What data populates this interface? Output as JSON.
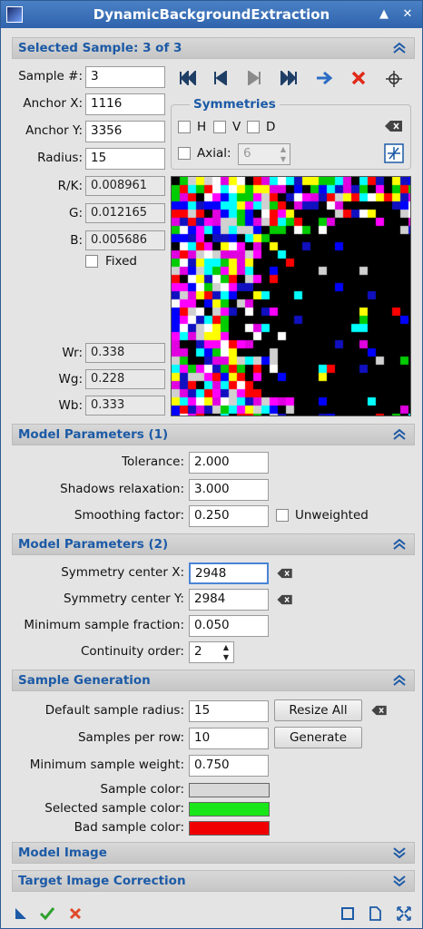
{
  "window": {
    "title": "DynamicBackgroundExtraction"
  },
  "selected_sample": {
    "header": "Selected Sample: 3 of 3",
    "sample_label": "Sample #:",
    "sample_value": "3",
    "anchor_x_label": "Anchor X:",
    "anchor_x_value": "1116",
    "anchor_y_label": "Anchor Y:",
    "anchor_y_value": "3356",
    "radius_label": "Radius:",
    "radius_value": "15",
    "rk_label": "R/K:",
    "rk_value": "0.008961",
    "g_label": "G:",
    "g_value": "0.012165",
    "b_label": "B:",
    "b_value": "0.005686",
    "fixed_label": "Fixed",
    "wr_label": "Wr:",
    "wr_value": "0.338",
    "wg_label": "Wg:",
    "wg_value": "0.228",
    "wb_label": "Wb:",
    "wb_value": "0.333",
    "symmetries": {
      "title": "Symmetries",
      "h": "H",
      "v": "V",
      "d": "D",
      "axial_label": "Axial:",
      "axial_value": "6"
    }
  },
  "model_params_1": {
    "header": "Model Parameters (1)",
    "tolerance_label": "Tolerance:",
    "tolerance_value": "2.000",
    "shadows_label": "Shadows relaxation:",
    "shadows_value": "3.000",
    "smoothing_label": "Smoothing factor:",
    "smoothing_value": "0.250",
    "unweighted_label": "Unweighted"
  },
  "model_params_2": {
    "header": "Model Parameters (2)",
    "sym_x_label": "Symmetry center X:",
    "sym_x_value": "2948",
    "sym_y_label": "Symmetry center Y:",
    "sym_y_value": "2984",
    "min_frac_label": "Minimum sample fraction:",
    "min_frac_value": "0.050",
    "continuity_label": "Continuity order:",
    "continuity_value": "2"
  },
  "sample_generation": {
    "header": "Sample Generation",
    "default_radius_label": "Default sample radius:",
    "default_radius_value": "15",
    "resize_all": "Resize All",
    "per_row_label": "Samples per row:",
    "per_row_value": "10",
    "generate": "Generate",
    "min_weight_label": "Minimum sample weight:",
    "min_weight_value": "0.750",
    "sample_color_label": "Sample color:",
    "sample_color": "#d8d8d8",
    "selected_color_label": "Selected sample color:",
    "selected_color": "#19e619",
    "bad_color_label": "Bad sample color:",
    "bad_color": "#f00000"
  },
  "model_image": {
    "header": "Model Image"
  },
  "target_correction": {
    "header": "Target Image Correction"
  }
}
